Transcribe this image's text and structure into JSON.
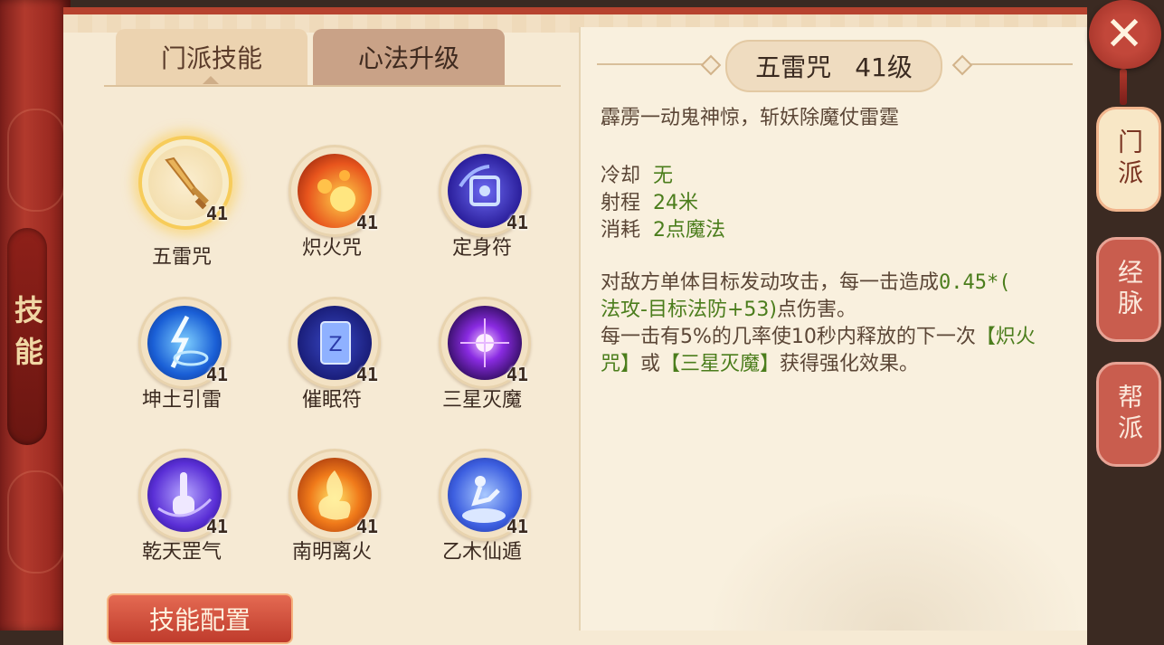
{
  "spine": {
    "label": "技能"
  },
  "tabs": [
    {
      "label": "门派技能",
      "active": true
    },
    {
      "label": "心法升级",
      "active": false
    }
  ],
  "skills": [
    {
      "name": "五雷咒",
      "level": "41",
      "icon": "sword-icon",
      "selected": true
    },
    {
      "name": "炽火咒",
      "level": "41",
      "icon": "fireball-icon",
      "selected": false
    },
    {
      "name": "定身符",
      "level": "41",
      "icon": "chain-seal-icon",
      "selected": false
    },
    {
      "name": "坤土引雷",
      "level": "41",
      "icon": "lightning-icon",
      "selected": false
    },
    {
      "name": "催眠符",
      "level": "41",
      "icon": "sleep-talisman-icon",
      "selected": false
    },
    {
      "name": "三星灭魔",
      "level": "41",
      "icon": "purple-burst-icon",
      "selected": false
    },
    {
      "name": "乾天罡气",
      "level": "41",
      "icon": "hand-gesture-icon",
      "selected": false
    },
    {
      "name": "南明离火",
      "level": "41",
      "icon": "flame-burst-icon",
      "selected": false
    },
    {
      "name": "乙木仙遁",
      "level": "41",
      "icon": "cloud-escape-icon",
      "selected": false
    }
  ],
  "config_button": "技能配置",
  "detail": {
    "name": "五雷咒",
    "level": "41级",
    "tagline": "霹雳一动鬼神惊，斩妖除魔仗雷霆",
    "stats": [
      {
        "label": "冷却",
        "value": "无"
      },
      {
        "label": "射程",
        "value": "24米"
      },
      {
        "label": "消耗",
        "value": "2点魔法"
      }
    ],
    "desc_line1_a": "对敌方单体目标发动攻击，每一击造成",
    "desc_line1_b": "0.45*(",
    "desc_line2_a": "法攻-目标法防+53)",
    "desc_line2_b": "点伤害。",
    "desc_line3_a": "每一击有5%的几率使10秒内释放的下一次",
    "desc_line3_b": "【炽火",
    "desc_line4_a": "咒】",
    "desc_line4_b": "或",
    "desc_line4_c": "【三星灭魔】",
    "desc_line4_d": "获得强化效果。"
  },
  "side_tabs": [
    {
      "label": "门派",
      "active": true
    },
    {
      "label": "经脉",
      "active": false
    },
    {
      "label": "帮派",
      "active": false
    }
  ],
  "close_label": "✕",
  "colors": {
    "accent_red": "#b7432f",
    "paper": "#f6ead4",
    "highlight_green": "#4b7d1c",
    "selected_glow": "#f7cc5a"
  }
}
